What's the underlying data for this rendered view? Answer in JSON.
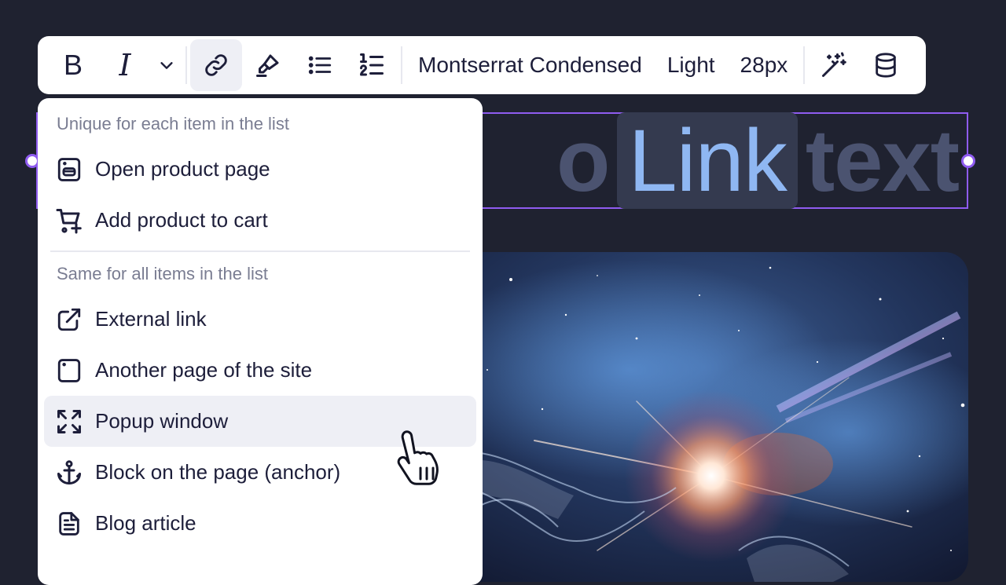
{
  "toolbar": {
    "bold_label": "B",
    "italic_label": "I",
    "font_family": "Montserrat Condensed",
    "font_weight": "Light",
    "font_size": "28px"
  },
  "heading": {
    "text_before": "o",
    "link_text": "Link",
    "text_after": "text"
  },
  "menu": {
    "section_unique": "Unique for each item in the list",
    "unique_items": [
      {
        "label": "Open product page",
        "icon": "product-page-icon"
      },
      {
        "label": "Add product to cart",
        "icon": "cart-plus-icon"
      }
    ],
    "section_same": "Same for all items in the list",
    "same_items": [
      {
        "label": "External link",
        "icon": "external-link-icon"
      },
      {
        "label": "Another page of the site",
        "icon": "page-icon"
      },
      {
        "label": "Popup window",
        "icon": "expand-icon",
        "hovered": true
      },
      {
        "label": "Block on the page (anchor)",
        "icon": "anchor-icon"
      },
      {
        "label": "Blog article",
        "icon": "document-icon"
      }
    ]
  },
  "colors": {
    "background": "#1f2230",
    "selection": "#8f5cf0",
    "text": "#1d1e3a",
    "muted": "#7a7d92",
    "hover": "#eeeff5",
    "link": "#8fb7f2"
  }
}
